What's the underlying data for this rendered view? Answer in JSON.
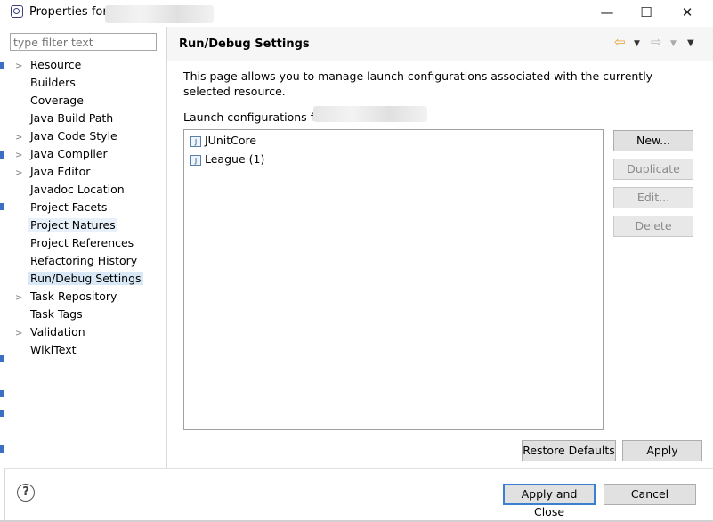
{
  "window": {
    "title": "Properties for",
    "minimize": "—",
    "maximize": "☐",
    "close": "✕"
  },
  "sidebar": {
    "filter_placeholder": "type filter text",
    "items": [
      {
        "label": "Resource",
        "expandable": true
      },
      {
        "label": "Builders",
        "expandable": false
      },
      {
        "label": "Coverage",
        "expandable": false
      },
      {
        "label": "Java Build Path",
        "expandable": false
      },
      {
        "label": "Java Code Style",
        "expandable": true
      },
      {
        "label": "Java Compiler",
        "expandable": true
      },
      {
        "label": "Java Editor",
        "expandable": true
      },
      {
        "label": "Javadoc Location",
        "expandable": false
      },
      {
        "label": "Project Facets",
        "expandable": false
      },
      {
        "label": "Project Natures",
        "expandable": false
      },
      {
        "label": "Project References",
        "expandable": false
      },
      {
        "label": "Refactoring History",
        "expandable": false
      },
      {
        "label": "Run/Debug Settings",
        "expandable": false
      },
      {
        "label": "Task Repository",
        "expandable": true
      },
      {
        "label": "Task Tags",
        "expandable": false
      },
      {
        "label": "Validation",
        "expandable": true
      },
      {
        "label": "WikiText",
        "expandable": false
      }
    ],
    "selected": "Run/Debug Settings"
  },
  "main": {
    "title": "Run/Debug Settings",
    "description": "This page allows you to manage launch configurations associated with the currently selected resource.",
    "launch_label": "Launch configurations fo",
    "configurations": [
      {
        "label": "JUnitCore",
        "icon": "junit-launch-icon"
      },
      {
        "label": "League (1)",
        "icon": "junit-launch-icon"
      }
    ],
    "buttons": {
      "new": "New...",
      "duplicate": "Duplicate",
      "edit": "Edit...",
      "delete": "Delete"
    },
    "restore_defaults": "Restore Defaults",
    "apply": "Apply"
  },
  "footer": {
    "help": "?",
    "apply_and_close": "Apply and Close",
    "cancel": "Cancel"
  },
  "colors": {
    "selection": "#d9e8f7",
    "default_button_border": "#3c7fd0",
    "nav_back_arrow": "#e8a33a"
  }
}
